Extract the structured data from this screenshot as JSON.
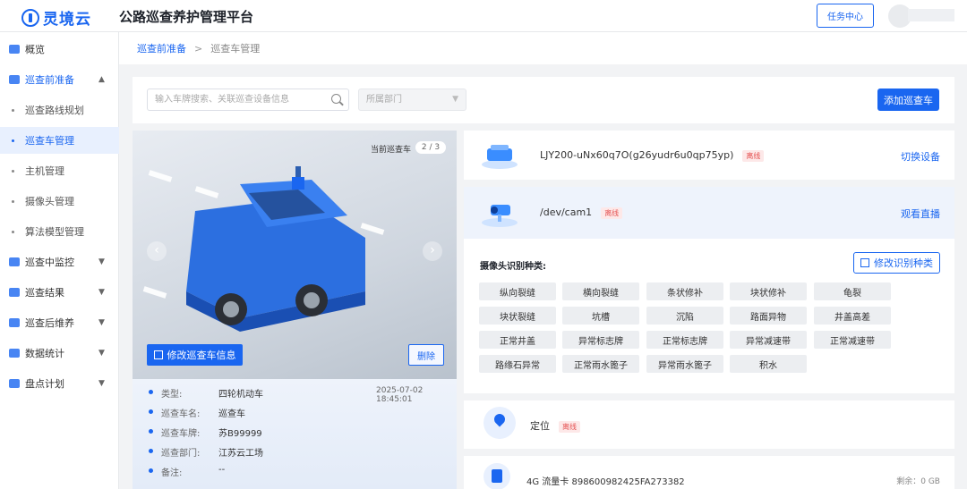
{
  "header": {
    "logo_text": "灵境云",
    "platform_title": "公路巡查养护管理平台",
    "task_center": "任务中心"
  },
  "sidebar": {
    "items": [
      {
        "label": "概览",
        "icon": "dashboard-icon"
      },
      {
        "label": "巡查前准备",
        "icon": "prep-icon",
        "expanded": true
      },
      {
        "label": "巡查路线规划",
        "sub": true
      },
      {
        "label": "巡查车管理",
        "sub": true,
        "active": true
      },
      {
        "label": "主机管理",
        "sub": true
      },
      {
        "label": "摄像头管理",
        "sub": true
      },
      {
        "label": "算法模型管理",
        "sub": true
      },
      {
        "label": "巡查中监控",
        "icon": "monitor-icon"
      },
      {
        "label": "巡查结果",
        "icon": "result-icon"
      },
      {
        "label": "巡查后维养",
        "icon": "maintain-icon"
      },
      {
        "label": "数据统计",
        "icon": "stats-icon"
      },
      {
        "label": "盘点计划",
        "icon": "plan-icon"
      }
    ]
  },
  "breadcrumb": {
    "parent": "巡查前准备",
    "sep": ">",
    "current": "巡查车管理"
  },
  "filter": {
    "search_placeholder": "输入车牌搜索、关联巡查设备信息",
    "dept_placeholder": "所属部门",
    "add_button": "添加巡查车"
  },
  "vehicle": {
    "counter_label": "当前巡查车",
    "counter_value": "2 / 3",
    "edit_button": "修改巡查车信息",
    "delete_button": "删除",
    "timestamp": "2025-07-02 18:45:01",
    "fields": [
      {
        "key": "类型:",
        "value": "四轮机动车"
      },
      {
        "key": "巡查车名:",
        "value": "巡查车"
      },
      {
        "key": "巡查车牌:",
        "value": "苏B99999"
      },
      {
        "key": "巡查部门:",
        "value": "江苏云工场"
      },
      {
        "key": "备注:",
        "value": "--"
      }
    ]
  },
  "devices": {
    "host": {
      "name": "LJY200-uNx60q7O(g26yudr6u0qp75yp)",
      "status": "离线",
      "action": "切换设备"
    },
    "camera": {
      "name": "/dev/cam1",
      "status": "离线",
      "action": "观看直播"
    },
    "location": {
      "name": "定位",
      "status": "离线"
    },
    "sim": {
      "name": "4G 流量卡 898600982425FA273382",
      "remaining": "剩余：0 GB"
    }
  },
  "recognition": {
    "title": "摄像头识别种类:",
    "edit_button": "修改识别种类",
    "types": [
      "纵向裂缝",
      "横向裂缝",
      "条状修补",
      "块状修补",
      "龟裂",
      "块状裂缝",
      "坑槽",
      "沉陷",
      "路面异物",
      "井盖高差",
      "正常井盖",
      "异常标志牌",
      "正常标志牌",
      "异常减速带",
      "正常减速带",
      "路缘石异常",
      "正常雨水篦子",
      "异常雨水篦子",
      "积水"
    ]
  },
  "colors": {
    "primary": "#1a66f0",
    "offline": "#e55353"
  }
}
